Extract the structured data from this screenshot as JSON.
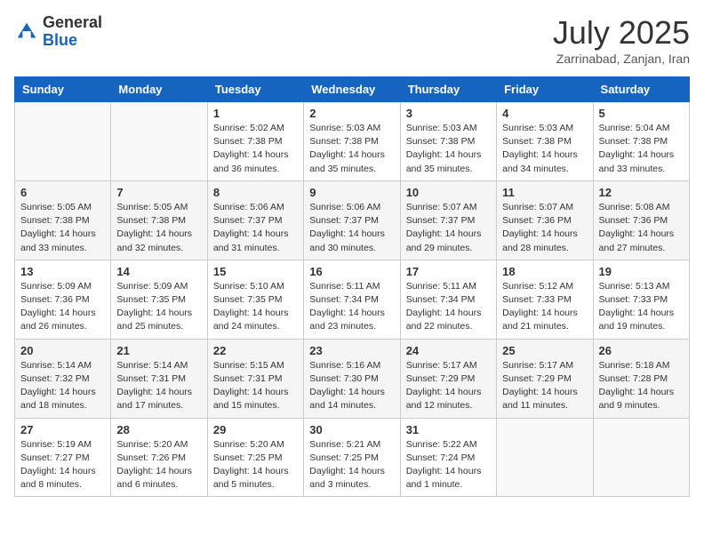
{
  "header": {
    "logo_general": "General",
    "logo_blue": "Blue",
    "month_title": "July 2025",
    "location": "Zarrinabad, Zanjan, Iran"
  },
  "weekdays": [
    "Sunday",
    "Monday",
    "Tuesday",
    "Wednesday",
    "Thursday",
    "Friday",
    "Saturday"
  ],
  "weeks": [
    [
      {
        "day": "",
        "sunrise": "",
        "sunset": "",
        "daylight": ""
      },
      {
        "day": "",
        "sunrise": "",
        "sunset": "",
        "daylight": ""
      },
      {
        "day": "1",
        "sunrise": "Sunrise: 5:02 AM",
        "sunset": "Sunset: 7:38 PM",
        "daylight": "Daylight: 14 hours and 36 minutes."
      },
      {
        "day": "2",
        "sunrise": "Sunrise: 5:03 AM",
        "sunset": "Sunset: 7:38 PM",
        "daylight": "Daylight: 14 hours and 35 minutes."
      },
      {
        "day": "3",
        "sunrise": "Sunrise: 5:03 AM",
        "sunset": "Sunset: 7:38 PM",
        "daylight": "Daylight: 14 hours and 35 minutes."
      },
      {
        "day": "4",
        "sunrise": "Sunrise: 5:03 AM",
        "sunset": "Sunset: 7:38 PM",
        "daylight": "Daylight: 14 hours and 34 minutes."
      },
      {
        "day": "5",
        "sunrise": "Sunrise: 5:04 AM",
        "sunset": "Sunset: 7:38 PM",
        "daylight": "Daylight: 14 hours and 33 minutes."
      }
    ],
    [
      {
        "day": "6",
        "sunrise": "Sunrise: 5:05 AM",
        "sunset": "Sunset: 7:38 PM",
        "daylight": "Daylight: 14 hours and 33 minutes."
      },
      {
        "day": "7",
        "sunrise": "Sunrise: 5:05 AM",
        "sunset": "Sunset: 7:38 PM",
        "daylight": "Daylight: 14 hours and 32 minutes."
      },
      {
        "day": "8",
        "sunrise": "Sunrise: 5:06 AM",
        "sunset": "Sunset: 7:37 PM",
        "daylight": "Daylight: 14 hours and 31 minutes."
      },
      {
        "day": "9",
        "sunrise": "Sunrise: 5:06 AM",
        "sunset": "Sunset: 7:37 PM",
        "daylight": "Daylight: 14 hours and 30 minutes."
      },
      {
        "day": "10",
        "sunrise": "Sunrise: 5:07 AM",
        "sunset": "Sunset: 7:37 PM",
        "daylight": "Daylight: 14 hours and 29 minutes."
      },
      {
        "day": "11",
        "sunrise": "Sunrise: 5:07 AM",
        "sunset": "Sunset: 7:36 PM",
        "daylight": "Daylight: 14 hours and 28 minutes."
      },
      {
        "day": "12",
        "sunrise": "Sunrise: 5:08 AM",
        "sunset": "Sunset: 7:36 PM",
        "daylight": "Daylight: 14 hours and 27 minutes."
      }
    ],
    [
      {
        "day": "13",
        "sunrise": "Sunrise: 5:09 AM",
        "sunset": "Sunset: 7:36 PM",
        "daylight": "Daylight: 14 hours and 26 minutes."
      },
      {
        "day": "14",
        "sunrise": "Sunrise: 5:09 AM",
        "sunset": "Sunset: 7:35 PM",
        "daylight": "Daylight: 14 hours and 25 minutes."
      },
      {
        "day": "15",
        "sunrise": "Sunrise: 5:10 AM",
        "sunset": "Sunset: 7:35 PM",
        "daylight": "Daylight: 14 hours and 24 minutes."
      },
      {
        "day": "16",
        "sunrise": "Sunrise: 5:11 AM",
        "sunset": "Sunset: 7:34 PM",
        "daylight": "Daylight: 14 hours and 23 minutes."
      },
      {
        "day": "17",
        "sunrise": "Sunrise: 5:11 AM",
        "sunset": "Sunset: 7:34 PM",
        "daylight": "Daylight: 14 hours and 22 minutes."
      },
      {
        "day": "18",
        "sunrise": "Sunrise: 5:12 AM",
        "sunset": "Sunset: 7:33 PM",
        "daylight": "Daylight: 14 hours and 21 minutes."
      },
      {
        "day": "19",
        "sunrise": "Sunrise: 5:13 AM",
        "sunset": "Sunset: 7:33 PM",
        "daylight": "Daylight: 14 hours and 19 minutes."
      }
    ],
    [
      {
        "day": "20",
        "sunrise": "Sunrise: 5:14 AM",
        "sunset": "Sunset: 7:32 PM",
        "daylight": "Daylight: 14 hours and 18 minutes."
      },
      {
        "day": "21",
        "sunrise": "Sunrise: 5:14 AM",
        "sunset": "Sunset: 7:31 PM",
        "daylight": "Daylight: 14 hours and 17 minutes."
      },
      {
        "day": "22",
        "sunrise": "Sunrise: 5:15 AM",
        "sunset": "Sunset: 7:31 PM",
        "daylight": "Daylight: 14 hours and 15 minutes."
      },
      {
        "day": "23",
        "sunrise": "Sunrise: 5:16 AM",
        "sunset": "Sunset: 7:30 PM",
        "daylight": "Daylight: 14 hours and 14 minutes."
      },
      {
        "day": "24",
        "sunrise": "Sunrise: 5:17 AM",
        "sunset": "Sunset: 7:29 PM",
        "daylight": "Daylight: 14 hours and 12 minutes."
      },
      {
        "day": "25",
        "sunrise": "Sunrise: 5:17 AM",
        "sunset": "Sunset: 7:29 PM",
        "daylight": "Daylight: 14 hours and 11 minutes."
      },
      {
        "day": "26",
        "sunrise": "Sunrise: 5:18 AM",
        "sunset": "Sunset: 7:28 PM",
        "daylight": "Daylight: 14 hours and 9 minutes."
      }
    ],
    [
      {
        "day": "27",
        "sunrise": "Sunrise: 5:19 AM",
        "sunset": "Sunset: 7:27 PM",
        "daylight": "Daylight: 14 hours and 8 minutes."
      },
      {
        "day": "28",
        "sunrise": "Sunrise: 5:20 AM",
        "sunset": "Sunset: 7:26 PM",
        "daylight": "Daylight: 14 hours and 6 minutes."
      },
      {
        "day": "29",
        "sunrise": "Sunrise: 5:20 AM",
        "sunset": "Sunset: 7:25 PM",
        "daylight": "Daylight: 14 hours and 5 minutes."
      },
      {
        "day": "30",
        "sunrise": "Sunrise: 5:21 AM",
        "sunset": "Sunset: 7:25 PM",
        "daylight": "Daylight: 14 hours and 3 minutes."
      },
      {
        "day": "31",
        "sunrise": "Sunrise: 5:22 AM",
        "sunset": "Sunset: 7:24 PM",
        "daylight": "Daylight: 14 hours and 1 minute."
      },
      {
        "day": "",
        "sunrise": "",
        "sunset": "",
        "daylight": ""
      },
      {
        "day": "",
        "sunrise": "",
        "sunset": "",
        "daylight": ""
      }
    ]
  ]
}
